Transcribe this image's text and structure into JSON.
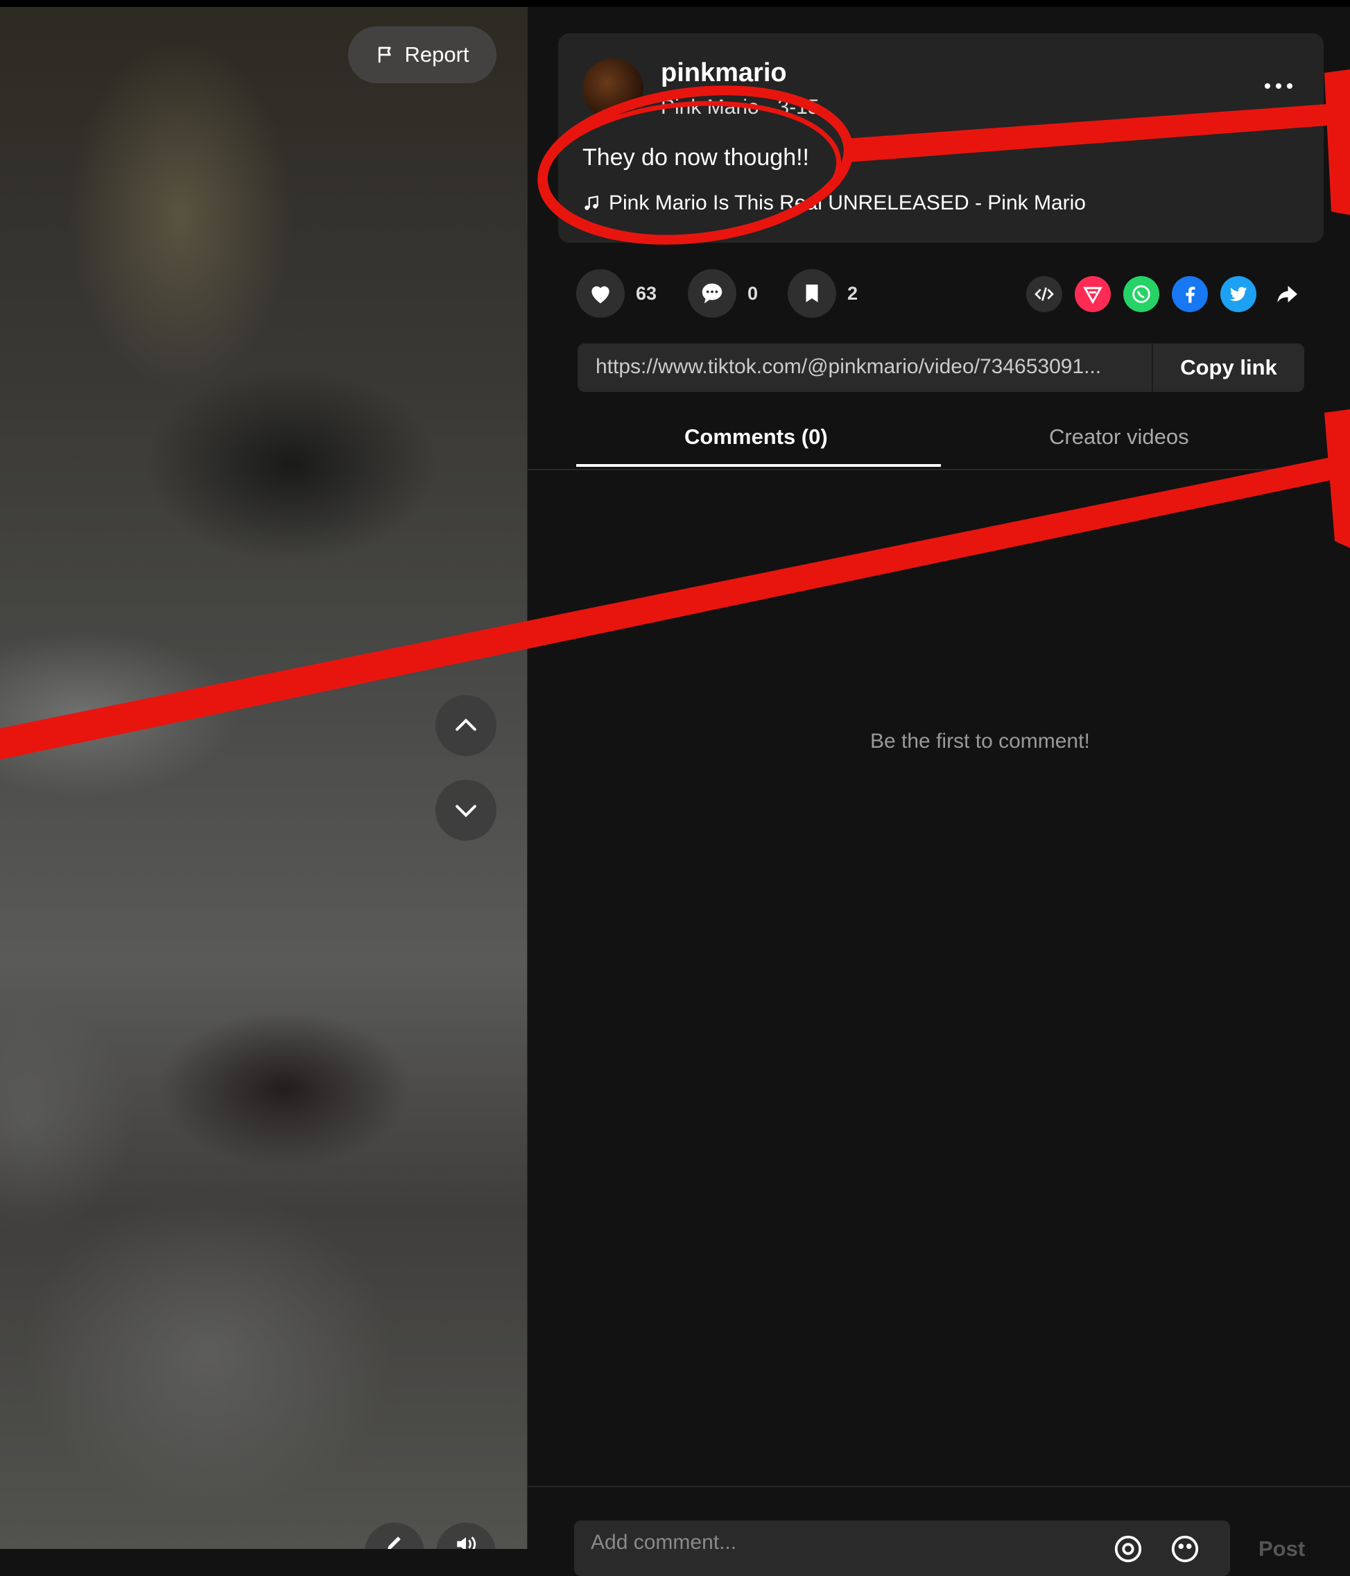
{
  "video": {
    "report_label": "Report"
  },
  "post": {
    "username": "pinkmario",
    "display_name": "Pink Mario",
    "date": "3-15",
    "caption": "They do now though!!",
    "music": "Pink Mario Is This Real UNRELEASED - Pink Mario"
  },
  "actions": {
    "likes": "63",
    "comments": "0",
    "saves": "2"
  },
  "share_icons": [
    "embed-icon",
    "send-to-friends-icon",
    "whatsapp-icon",
    "facebook-icon",
    "twitter-icon",
    "share-arrow-icon"
  ],
  "link": {
    "url": "https://www.tiktok.com/@pinkmario/video/734653091...",
    "copy_label": "Copy link"
  },
  "tabs": [
    {
      "label": "Comments (0)",
      "active": true
    },
    {
      "label": "Creator videos",
      "active": false
    }
  ],
  "comments": {
    "empty_text": "Be the first to comment!",
    "placeholder": "Add comment...",
    "post_label": "Post"
  },
  "colors": {
    "annotation_red": "#e8150f",
    "background": "#121212",
    "card": "#242424"
  }
}
